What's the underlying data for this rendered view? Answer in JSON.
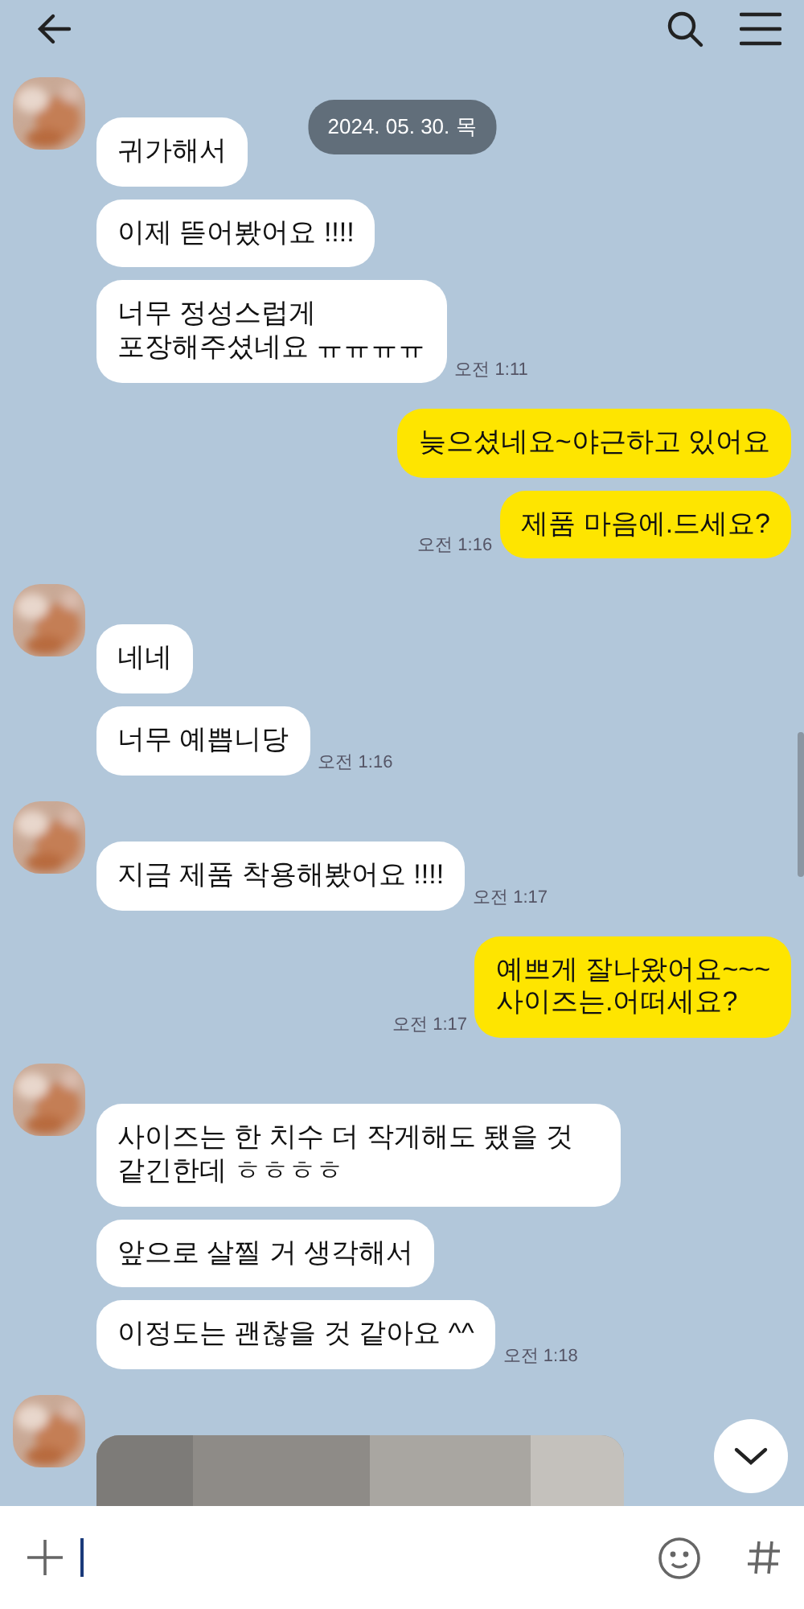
{
  "date_divider": "2024. 05. 30. 목",
  "groups": [
    {
      "kind": "received",
      "bubbles": [
        {
          "kind": "text",
          "text": "귀가해서"
        },
        {
          "kind": "text",
          "text": "이제 뜯어봤어요 !!!!"
        },
        {
          "kind": "text",
          "text": "너무 정성스럽게\n포장해주셨네요 ㅠㅠㅠㅠ"
        }
      ],
      "time": "오전 1:11"
    },
    {
      "kind": "sent",
      "bubbles": [
        {
          "kind": "text",
          "text": "늦으셨네요~야근하고 있어요"
        },
        {
          "kind": "text",
          "text": "제품 마음에.드세요?"
        }
      ],
      "time": "오전 1:16"
    },
    {
      "kind": "received",
      "bubbles": [
        {
          "kind": "text",
          "text": "네네"
        },
        {
          "kind": "text",
          "text": "너무 예쁩니당"
        }
      ],
      "time": "오전 1:16"
    },
    {
      "kind": "received",
      "bubbles": [
        {
          "kind": "text",
          "text": "지금 제품 착용해봤어요 !!!!"
        }
      ],
      "time": "오전 1:17"
    },
    {
      "kind": "sent",
      "bubbles": [
        {
          "kind": "text",
          "text": "예쁘게 잘나왔어요~~~\n사이즈는.어떠세요?"
        }
      ],
      "time": "오전 1:17"
    },
    {
      "kind": "received",
      "bubbles": [
        {
          "kind": "text",
          "text": "사이즈는 한 치수 더 작게해도 됐을 것 같긴한데 ㅎㅎㅎㅎ"
        },
        {
          "kind": "text",
          "text": "앞으로 살찔 거 생각해서"
        },
        {
          "kind": "text",
          "text": "이정도는 괜찮을 것 같아요 ^^"
        }
      ],
      "time": "오전 1:18"
    },
    {
      "kind": "received"
    }
  ]
}
